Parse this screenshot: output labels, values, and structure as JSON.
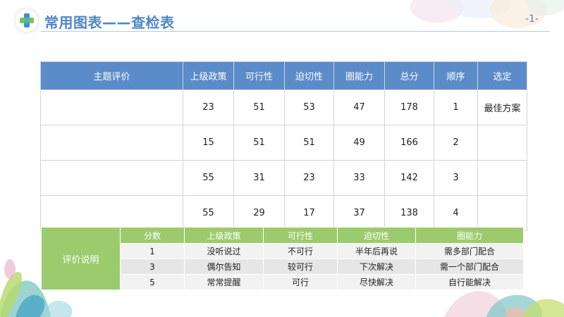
{
  "header": {
    "title": "常用图表——查检表",
    "page_number": "-1-"
  },
  "table": {
    "headers": [
      "主题评价",
      "上级政策",
      "可行性",
      "迫切性",
      "圈能力",
      "总分",
      "顺序",
      "选定"
    ],
    "rows": [
      [
        "",
        "23",
        "51",
        "53",
        "47",
        "178",
        "1",
        "最佳方案"
      ],
      [
        "",
        "15",
        "51",
        "51",
        "49",
        "166",
        "2",
        ""
      ],
      [
        "",
        "55",
        "31",
        "23",
        "33",
        "142",
        "3",
        ""
      ],
      [
        "",
        "55",
        "29",
        "17",
        "37",
        "138",
        "4",
        ""
      ]
    ]
  },
  "legend": {
    "side_label": "评价说明",
    "headers": [
      "分数",
      "上级政策",
      "可行性",
      "迫切性",
      "圈能力"
    ],
    "rows": [
      [
        "1",
        "没听说过",
        "不可行",
        "半年后再说",
        "需多部门配合"
      ],
      [
        "3",
        "偶尔告知",
        "较可行",
        "下次解决",
        "需一个部门配合"
      ],
      [
        "5",
        "常常提醒",
        "可行",
        "尽快解决",
        "自行能解决"
      ]
    ]
  },
  "colors": {
    "accent_blue": "#4f86c6",
    "table_header": "#5b8bc9",
    "legend_green": "#9ccb6e",
    "logo_blue": "#3a8fd8",
    "logo_green": "#7bc24f"
  },
  "icons": {
    "logo": "medical-cross-logo"
  }
}
